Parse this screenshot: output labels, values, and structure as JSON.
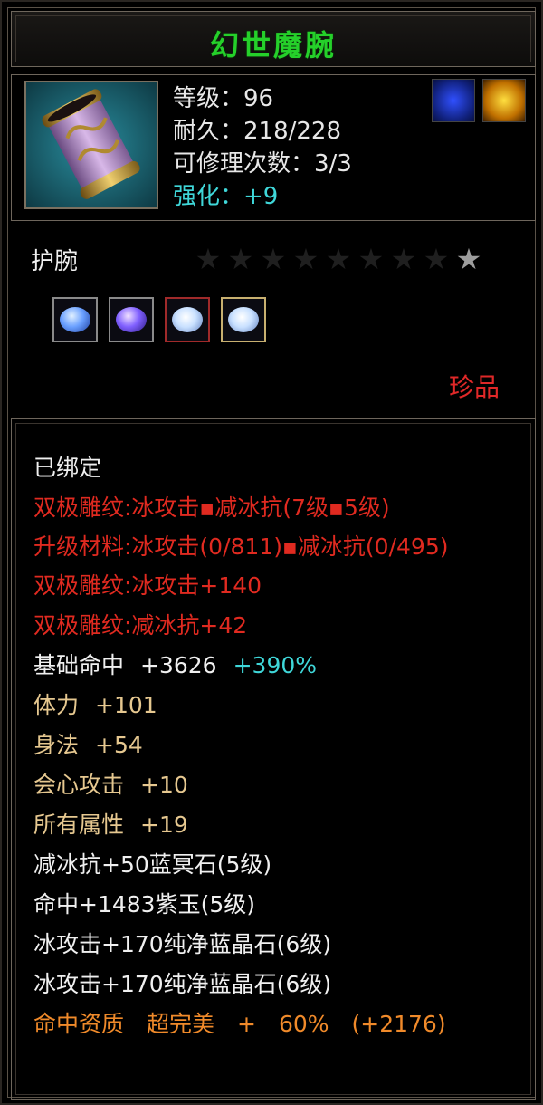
{
  "item": {
    "name": "幻世魔腕",
    "level": "等级：96",
    "durability": "耐久：218/228",
    "repairs": "可修理次数：3/3",
    "enhance": "强化：+9",
    "type": "护腕",
    "rarity": "珍品",
    "icon": "bracer-icon"
  },
  "badges": [
    "blue-flame-emblem-icon",
    "gold-flame-emblem-icon"
  ],
  "stars": {
    "total": 9,
    "lit": 1
  },
  "gems": [
    {
      "name": "blue-gem-icon",
      "color": "#6aa0ff"
    },
    {
      "name": "purple-gem-icon",
      "color": "#8060ff"
    },
    {
      "name": "white-gem-icon",
      "color": "#c8e0ff"
    },
    {
      "name": "white-gem-icon",
      "color": "#c8e0ff"
    }
  ],
  "details": {
    "bound": "已绑定",
    "carve1": "双极雕纹:冰攻击▪减冰抗(7级▪5级)",
    "upgrade": "升级材料:冰攻击(0/811)▪减冰抗(0/495)",
    "carve2": "双极雕纹:冰攻击+140",
    "carve3": "双极雕纹:减冰抗+42",
    "hit_label": "基础命中",
    "hit_value": "+3626",
    "hit_pct": "+390%",
    "vit_label": "体力",
    "vit_value": "+101",
    "agi_label": "身法",
    "agi_value": "+54",
    "crit_label": "会心攻击",
    "crit_value": "+10",
    "all_label": "所有属性",
    "all_value": "+19",
    "gem1": "减冰抗+50蓝冥石(5级)",
    "gem2": "命中+1483紫玉(5级)",
    "gem3": "冰攻击+170纯净蓝晶石(6级)",
    "gem4": "冰攻击+170纯净蓝晶石(6级)",
    "aptitude": "命中资质　超完美　+　60%　(+2176)"
  },
  "colors": {
    "title": "#25d02a",
    "red": "#e02a20",
    "gold": "#e6c890",
    "cyan": "#3fd7d9",
    "orange": "#f08a2a"
  }
}
